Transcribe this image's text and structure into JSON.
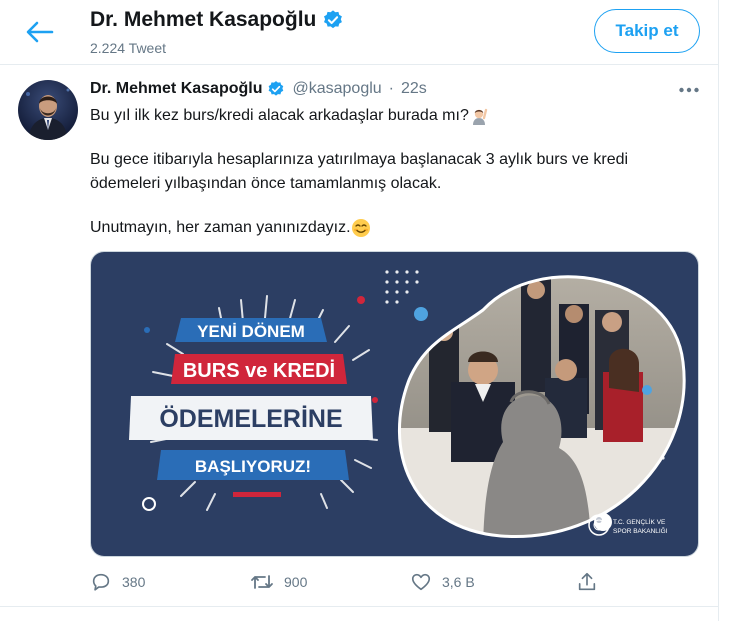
{
  "header": {
    "name": "Dr. Mehmet Kasapoğlu",
    "tweet_count": "2.224 Tweet",
    "follow_label": "Takip et"
  },
  "tweet": {
    "author_name": "Dr. Mehmet Kasapoğlu",
    "handle": "@kasapoglu",
    "separator": "·",
    "time": "22s",
    "line1": "Bu yıl ilk kez burs/kredi alacak arkadaşlar burada mı?",
    "line2": "Bu gece itibarıyla hesaplarınıza yatırılmaya başlanacak 3 aylık burs ve kredi",
    "line3": "ödemeleri yılbaşından önce tamamlanmış olacak.",
    "line4": "Unutmayın, her zaman yanınızdayız."
  },
  "media": {
    "banner_line1": "YENİ DÖNEM",
    "banner_line2": "BURS ve KREDİ",
    "banner_line3": "ÖDEMELERİNE",
    "banner_line4": "BAŞLIYORUZ!",
    "logo_line1": "T.C. GENÇLİK VE",
    "logo_line2": "SPOR BAKANLIĞI"
  },
  "actions": {
    "replies": "380",
    "retweets": "900",
    "likes": "3,6 B"
  },
  "icons": [
    "back-arrow-icon",
    "verified-badge-icon",
    "more-icon",
    "raising-hand-emoji",
    "smiling-emoji",
    "reply-icon",
    "retweet-icon",
    "like-icon",
    "share-icon"
  ],
  "colors": {
    "accent": "#1da1f2",
    "muted": "#657786",
    "banner_navy": "#2c3e63",
    "banner_red": "#d0263b"
  }
}
